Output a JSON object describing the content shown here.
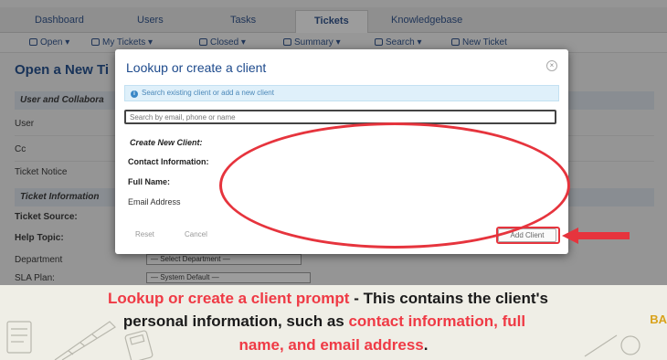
{
  "nav": {
    "tabs": [
      "Dashboard",
      "Users",
      "Tasks",
      "Tickets",
      "Knowledgebase"
    ],
    "active": "Tickets"
  },
  "subnav": [
    "Open",
    "My Tickets",
    "Closed",
    "Summary",
    "Search",
    "New Ticket"
  ],
  "page": {
    "title": "Open a New Ti",
    "section1": "User and Collabora",
    "user_label": "User",
    "cc_label": "Cc",
    "notice_label": "Ticket Notice",
    "section2": "Ticket Information",
    "source_label": "Ticket Source:",
    "help_label": "Help Topic:",
    "dept_label": "Department",
    "dept_value": "— Select Department —",
    "sla_label": "SLA Plan:",
    "sla_value": "— System Default —"
  },
  "modal": {
    "title": "Lookup or create a client",
    "close": "×",
    "info": "Search existing client or add a new client",
    "search_placeholder": "Search by email, phone or name",
    "create_label": "Create New Client:",
    "contact_label": "Contact Information:",
    "fullname_label": "Full Name:",
    "email_label": "Email Address",
    "reset": "Reset",
    "cancel": "Cancel",
    "add_client": "Add Client"
  },
  "caption": {
    "title": "Lookup or create a client prompt",
    "dash": " - ",
    "text1": "This contains the client's",
    "text2": "personal information, such as ",
    "hl1": "contact information, full",
    "hl2": "name, and email address",
    "end": ".",
    "brand": "BA"
  },
  "colors": {
    "accent_red": "#ef3a45",
    "link_blue": "#1d4a8c",
    "brand_gold": "#d9a21b"
  }
}
